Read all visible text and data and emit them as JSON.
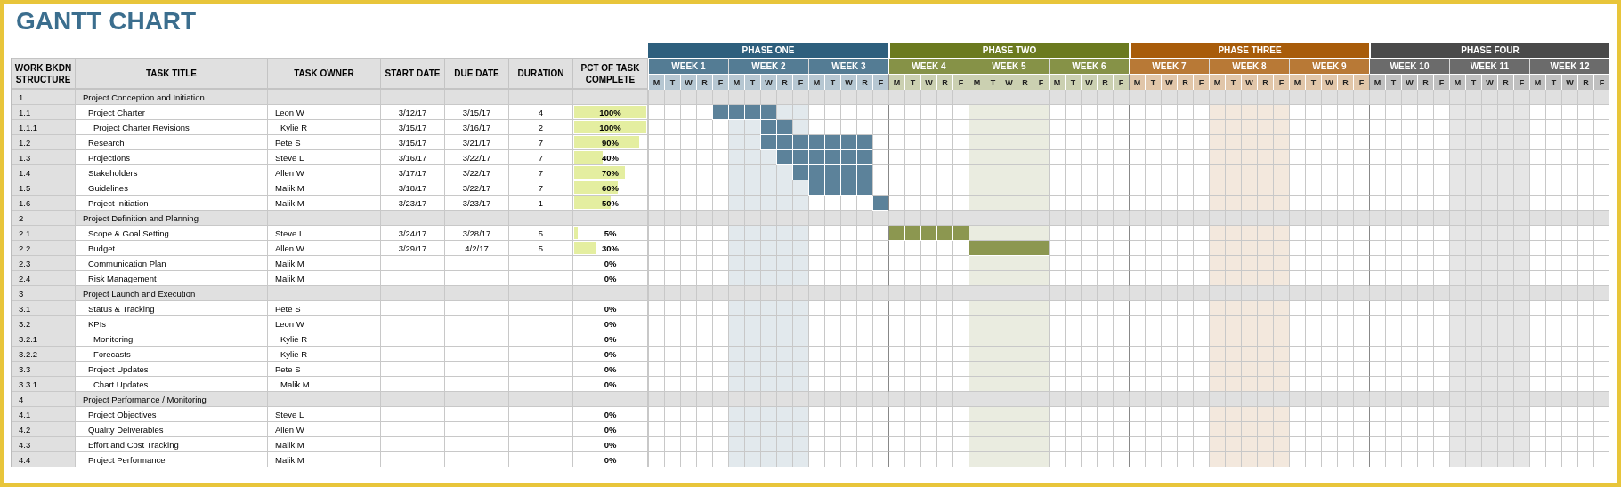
{
  "title": "GANTT CHART",
  "columns": [
    "WORK BKDN STRUCTURE",
    "TASK TITLE",
    "TASK OWNER",
    "START DATE",
    "DUE DATE",
    "DURATION",
    "PCT OF TASK COMPLETE"
  ],
  "phases": [
    {
      "name": "PHASE ONE",
      "color": "#2e5f7d",
      "weeks": [
        {
          "name": "WEEK 1",
          "highlighted": false,
          "days": [
            "M",
            "T",
            "W",
            "R",
            "F"
          ]
        },
        {
          "name": "WEEK 2",
          "highlighted": true,
          "days": [
            "M",
            "T",
            "W",
            "R",
            "F"
          ]
        },
        {
          "name": "WEEK 3",
          "highlighted": false,
          "days": [
            "M",
            "T",
            "W",
            "R",
            "F"
          ]
        }
      ]
    },
    {
      "name": "PHASE TWO",
      "color": "#6b7a1f",
      "weeks": [
        {
          "name": "WEEK 4",
          "highlighted": false,
          "days": [
            "M",
            "T",
            "W",
            "R",
            "F"
          ]
        },
        {
          "name": "WEEK 5",
          "highlighted": true,
          "days": [
            "M",
            "T",
            "W",
            "R",
            "F"
          ]
        },
        {
          "name": "WEEK 6",
          "highlighted": false,
          "days": [
            "M",
            "T",
            "W",
            "R",
            "F"
          ]
        }
      ]
    },
    {
      "name": "PHASE THREE",
      "color": "#a85c0a",
      "weeks": [
        {
          "name": "WEEK 7",
          "highlighted": false,
          "days": [
            "M",
            "T",
            "W",
            "R",
            "F"
          ]
        },
        {
          "name": "WEEK 8",
          "highlighted": true,
          "days": [
            "M",
            "T",
            "W",
            "R",
            "F"
          ]
        },
        {
          "name": "WEEK 9",
          "highlighted": false,
          "days": [
            "M",
            "T",
            "W",
            "R",
            "F"
          ]
        }
      ]
    },
    {
      "name": "PHASE FOUR",
      "color": "#4a4a4a",
      "weeks": [
        {
          "name": "WEEK 10",
          "highlighted": false,
          "days": [
            "M",
            "T",
            "W",
            "R",
            "F"
          ]
        },
        {
          "name": "WEEK 11",
          "highlighted": true,
          "days": [
            "M",
            "T",
            "W",
            "R",
            "F"
          ]
        },
        {
          "name": "WEEK 12",
          "highlighted": false,
          "days": [
            "M",
            "T",
            "W",
            "R",
            "F"
          ]
        }
      ]
    }
  ],
  "sections": [
    {
      "wbs": "1",
      "title": "Project Conception and Initiation",
      "tasks": [
        {
          "wbs": "1.1",
          "title": "Project Charter",
          "owner": "Leon W",
          "start": "3/12/17",
          "due": "3/15/17",
          "duration": "4",
          "pct": "100%",
          "level": 1,
          "schedule": [
            false,
            false,
            false,
            false,
            true,
            true,
            true,
            true
          ],
          "children": [
            {
              "wbs": "1.1.1",
              "title": "Project Charter Revisions",
              "owner": "Kylie R",
              "start": "3/15/17",
              "due": "3/16/17",
              "duration": "2",
              "pct": "100%",
              "level": 1,
              "schedule": [
                false,
                false,
                false,
                false,
                false,
                false,
                false,
                true,
                true
              ]
            }
          ]
        },
        {
          "wbs": "1.2",
          "title": "Research",
          "owner": "Pete S",
          "start": "3/15/17",
          "due": "3/21/17",
          "duration": "7",
          "pct": "90%",
          "level": 0.9,
          "schedule": [
            false,
            false,
            false,
            false,
            false,
            false,
            false,
            true,
            true,
            true,
            true,
            true,
            true,
            true
          ]
        },
        {
          "wbs": "1.3",
          "title": "Projections",
          "owner": "Steve L",
          "start": "3/16/17",
          "due": "3/22/17",
          "duration": "7",
          "pct": "40%",
          "level": 0.4,
          "schedule": [
            false,
            false,
            false,
            false,
            false,
            false,
            false,
            false,
            true,
            true,
            true,
            true,
            true,
            true
          ]
        },
        {
          "wbs": "1.4",
          "title": "Stakeholders",
          "owner": "Allen W",
          "start": "3/17/17",
          "due": "3/22/17",
          "duration": "7",
          "pct": "70%",
          "level": 0.7,
          "schedule": [
            false,
            false,
            false,
            false,
            false,
            false,
            false,
            false,
            false,
            true,
            true,
            true,
            true,
            true
          ]
        },
        {
          "wbs": "1.5",
          "title": "Guidelines",
          "owner": "Malik M",
          "start": "3/18/17",
          "due": "3/22/17",
          "duration": "7",
          "pct": "60%",
          "level": 0.6,
          "schedule": [
            false,
            false,
            false,
            false,
            false,
            false,
            false,
            false,
            false,
            false,
            true,
            true,
            true,
            true
          ]
        },
        {
          "wbs": "1.6",
          "title": "Project Initiation",
          "owner": "Malik M",
          "start": "3/23/17",
          "due": "3/23/17",
          "duration": "1",
          "pct": "50%",
          "level": 0.5,
          "schedule": [
            false,
            false,
            false,
            false,
            false,
            false,
            false,
            false,
            false,
            false,
            false,
            false,
            false,
            false,
            true
          ]
        }
      ]
    },
    {
      "wbs": "2",
      "title": "Project Definition and Planning",
      "tasks": [
        {
          "wbs": "2.1",
          "title": "Scope & Goal Setting",
          "owner": "Steve L",
          "start": "3/24/17",
          "due": "3/28/17",
          "duration": "5",
          "pct": "5%",
          "level": 0.05,
          "schedule": [
            false,
            false,
            false,
            false,
            false,
            false,
            false,
            false,
            false,
            false,
            false,
            false,
            false,
            false,
            false,
            true,
            true,
            true,
            true,
            true
          ]
        },
        {
          "wbs": "2.2",
          "title": "Budget",
          "owner": "Allen W",
          "start": "3/29/17",
          "due": "4/2/17",
          "duration": "5",
          "pct": "30%",
          "level": 0.3,
          "schedule": [
            false,
            false,
            false,
            false,
            false,
            false,
            false,
            false,
            false,
            false,
            false,
            false,
            false,
            false,
            false,
            false,
            false,
            false,
            false,
            false,
            true,
            true,
            true,
            true,
            true
          ]
        },
        {
          "wbs": "2.3",
          "title": "Communication Plan",
          "owner": "Malik M",
          "pct": "0%"
        },
        {
          "wbs": "2.4",
          "title": "Risk Management",
          "owner": "Malik M",
          "pct": "0%"
        }
      ]
    },
    {
      "wbs": "3",
      "title": "Project Launch and Execution",
      "tasks": [
        {
          "wbs": "3.1",
          "title": "Status & Tracking",
          "owner": "Pete S",
          "pct": "0%"
        },
        {
          "wbs": "3.2",
          "title": "KPIs",
          "owner": "Leon W",
          "pct": "0%",
          "children": [
            {
              "wbs": "3.2.1",
              "title": "Monitoring",
              "owner": "Kylie R",
              "pct": "0%"
            },
            {
              "wbs": "3.2.2",
              "title": "Forecasts",
              "owner": "Kylie R",
              "pct": "0%"
            }
          ]
        },
        {
          "wbs": "3.3",
          "title": "Project Updates",
          "owner": "Pete S",
          "pct": "0%",
          "children": [
            {
              "wbs": "3.3.1",
              "title": "Chart Updates",
              "owner": "Malik M",
              "pct": "0%"
            }
          ]
        }
      ]
    },
    {
      "wbs": "4",
      "title": "Project Performance / Monitoring",
      "tasks": [
        {
          "wbs": "4.1",
          "title": "Project Objectives",
          "owner": "Steve L",
          "pct": "0%"
        },
        {
          "wbs": "4.2",
          "title": "Quality Deliverables",
          "owner": "Allen W",
          "pct": "0%"
        },
        {
          "wbs": "4.3",
          "title": "Effort and Cost Tracking",
          "owner": "Malik M",
          "pct": "0%"
        },
        {
          "wbs": "4.4",
          "title": "Project Performance",
          "owner": "Malik M",
          "pct": "0%"
        }
      ]
    }
  ]
}
